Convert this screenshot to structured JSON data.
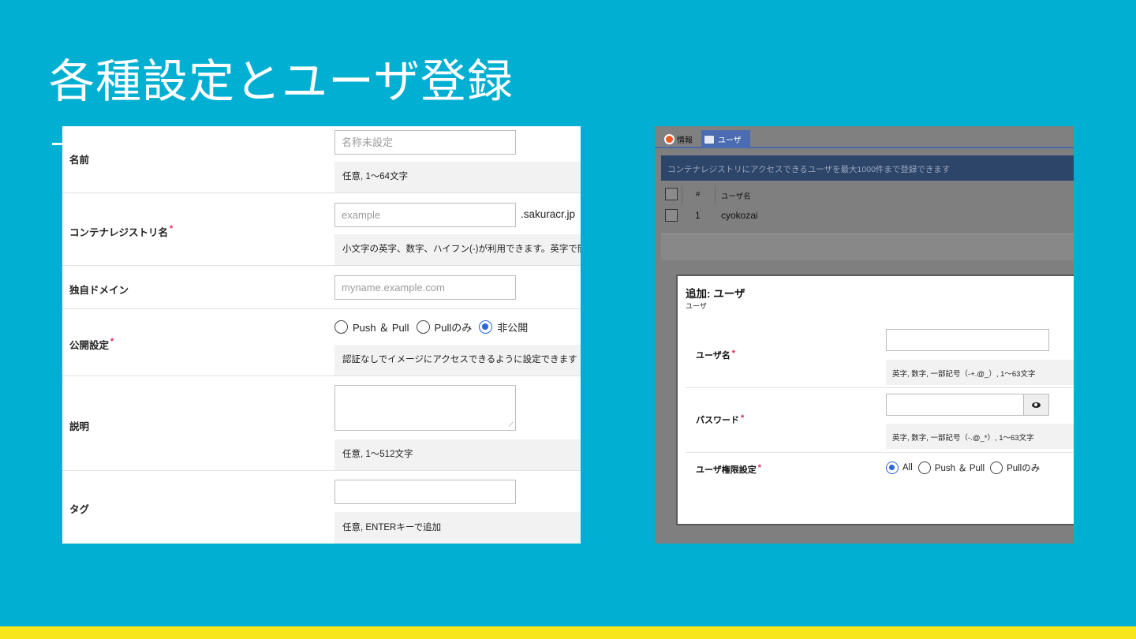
{
  "slide": {
    "title": "各種設定とユーザ登録"
  },
  "left_form": {
    "required_mark": "*",
    "name": {
      "label": "名前",
      "placeholder": "名称未設定",
      "hint": "任意, 1〜64文字"
    },
    "registry": {
      "label": "コンテナレジストリ名",
      "placeholder": "example",
      "suffix": ".sakuracr.jp",
      "hint": "小文字の英字、数字、ハイフン(-)が利用できます。英字で開"
    },
    "domain": {
      "label": "独自ドメイン",
      "placeholder": "myname.example.com"
    },
    "visibility": {
      "label": "公開設定",
      "options": [
        "Push ＆ Pull",
        "Pullのみ",
        "非公開"
      ],
      "selected": "非公開",
      "hint": "認証なしでイメージにアクセスできるように設定できます"
    },
    "description": {
      "label": "説明",
      "hint": "任意, 1〜512文字"
    },
    "tags": {
      "label": "タグ",
      "hint": "任意, ENTERキーで追加"
    }
  },
  "right_panel": {
    "tabs": [
      {
        "label": "情報",
        "icon": "info-icon"
      },
      {
        "label": "ユーザ",
        "icon": "users-icon"
      }
    ],
    "notice": "コンテナレジストリにアクセスできるユーザを最大1000件まで登録できます",
    "list": {
      "columns": [
        "#",
        "ユーザ名"
      ],
      "rows": [
        {
          "index": "1",
          "username": "cyokozai"
        }
      ]
    },
    "modal": {
      "title": "追加: ユーザ",
      "subtitle": "ユーザ",
      "username": {
        "label": "ユーザ名",
        "hint": "英字, 数字, 一部記号（-+.@_）, 1〜63文字"
      },
      "password": {
        "label": "パスワード",
        "hint": "英字, 数字, 一部記号（-.@_*）, 1〜63文字"
      },
      "permission": {
        "label": "ユーザ権限設定",
        "options": [
          "All",
          "Push ＆ Pull",
          "Pullのみ"
        ],
        "selected": "All"
      }
    }
  },
  "colors": {
    "background": "#00afd1",
    "accent_bar": "#f7e61c",
    "radio_selected": "#2a66d8",
    "required": "#e0284f"
  }
}
